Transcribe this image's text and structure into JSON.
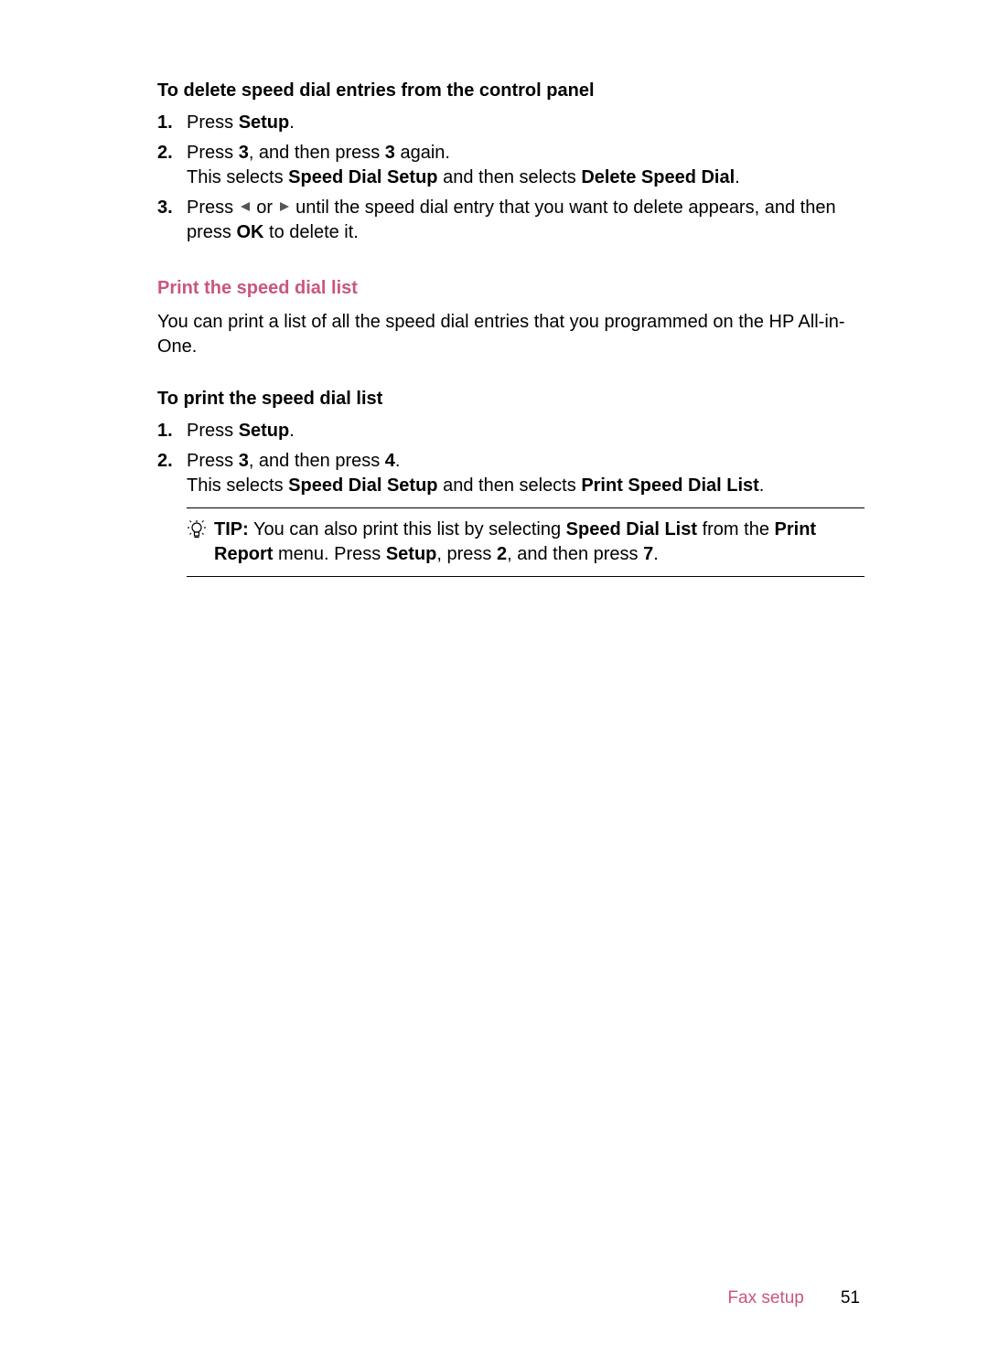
{
  "section1": {
    "heading": "To delete speed dial entries from the control panel",
    "steps": [
      {
        "num": "1.",
        "pre": "Press ",
        "b1": "Setup",
        "post": "."
      },
      {
        "num": "2.",
        "pre": "Press ",
        "b1": "3",
        "mid": ", and then press ",
        "b2": "3",
        "post": " again.",
        "line2_pre": "This selects ",
        "line2_b1": "Speed Dial Setup",
        "line2_mid": " and then selects ",
        "line2_b2": "Delete Speed Dial",
        "line2_post": "."
      },
      {
        "num": "3.",
        "pre": "Press ",
        "mid1": " or ",
        "mid2": " until the speed dial entry that you want to delete appears, and then press ",
        "b1": "OK",
        "post": " to delete it."
      }
    ]
  },
  "section2": {
    "heading": "Print the speed dial list",
    "para": "You can print a list of all the speed dial entries that you programmed on the HP All-in-One."
  },
  "section3": {
    "heading": "To print the speed dial list",
    "steps": [
      {
        "num": "1.",
        "pre": "Press ",
        "b1": "Setup",
        "post": "."
      },
      {
        "num": "2.",
        "pre": "Press ",
        "b1": "3",
        "mid": ", and then press ",
        "b2": "4",
        "post": ".",
        "line2_pre": "This selects ",
        "line2_b1": "Speed Dial Setup",
        "line2_mid": " and then selects ",
        "line2_b2": "Print Speed Dial List",
        "line2_post": "."
      }
    ]
  },
  "tip": {
    "label": "TIP:",
    "t1": "  You can also print this list by selecting ",
    "b1": "Speed Dial List",
    "t2": " from the ",
    "b2": "Print Report",
    "t3": " menu. Press ",
    "b3": "Setup",
    "t4": ", press ",
    "b4": "2",
    "t5": ", and then press ",
    "b5": "7",
    "t6": "."
  },
  "footer": {
    "label": "Fax setup",
    "page": "51"
  }
}
